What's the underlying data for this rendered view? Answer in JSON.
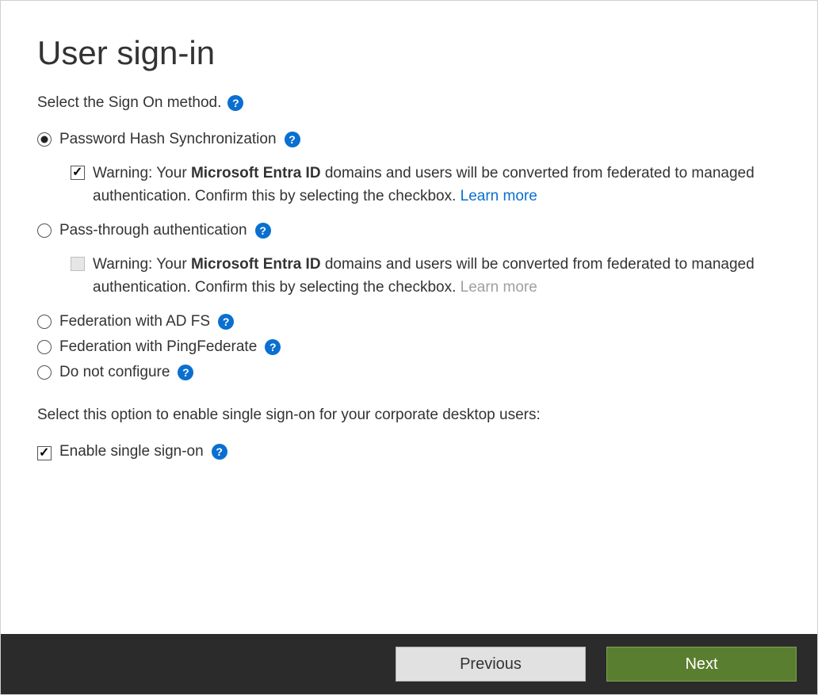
{
  "title": "User sign-in",
  "intro": "Select the Sign On method.",
  "options": {
    "phs": {
      "label": "Password Hash Synchronization",
      "warning_prefix": "Warning: Your ",
      "warning_bold": "Microsoft Entra ID",
      "warning_suffix": " domains and users will be converted from federated to managed authentication. Confirm this by selecting the checkbox. ",
      "learn_more": "Learn more"
    },
    "pta": {
      "label": "Pass-through authentication",
      "warning_prefix": "Warning: Your ",
      "warning_bold": "Microsoft Entra ID",
      "warning_suffix": " domains and users will be converted from federated to managed authentication. Confirm this by selecting the checkbox. ",
      "learn_more": "Learn more"
    },
    "adfs": {
      "label": "Federation with AD FS"
    },
    "ping": {
      "label": "Federation with PingFederate"
    },
    "none": {
      "label": "Do not configure"
    }
  },
  "sso": {
    "intro": "Select this option to enable single sign-on for your corporate desktop users:",
    "label": "Enable single sign-on"
  },
  "footer": {
    "previous": "Previous",
    "next": "Next"
  }
}
